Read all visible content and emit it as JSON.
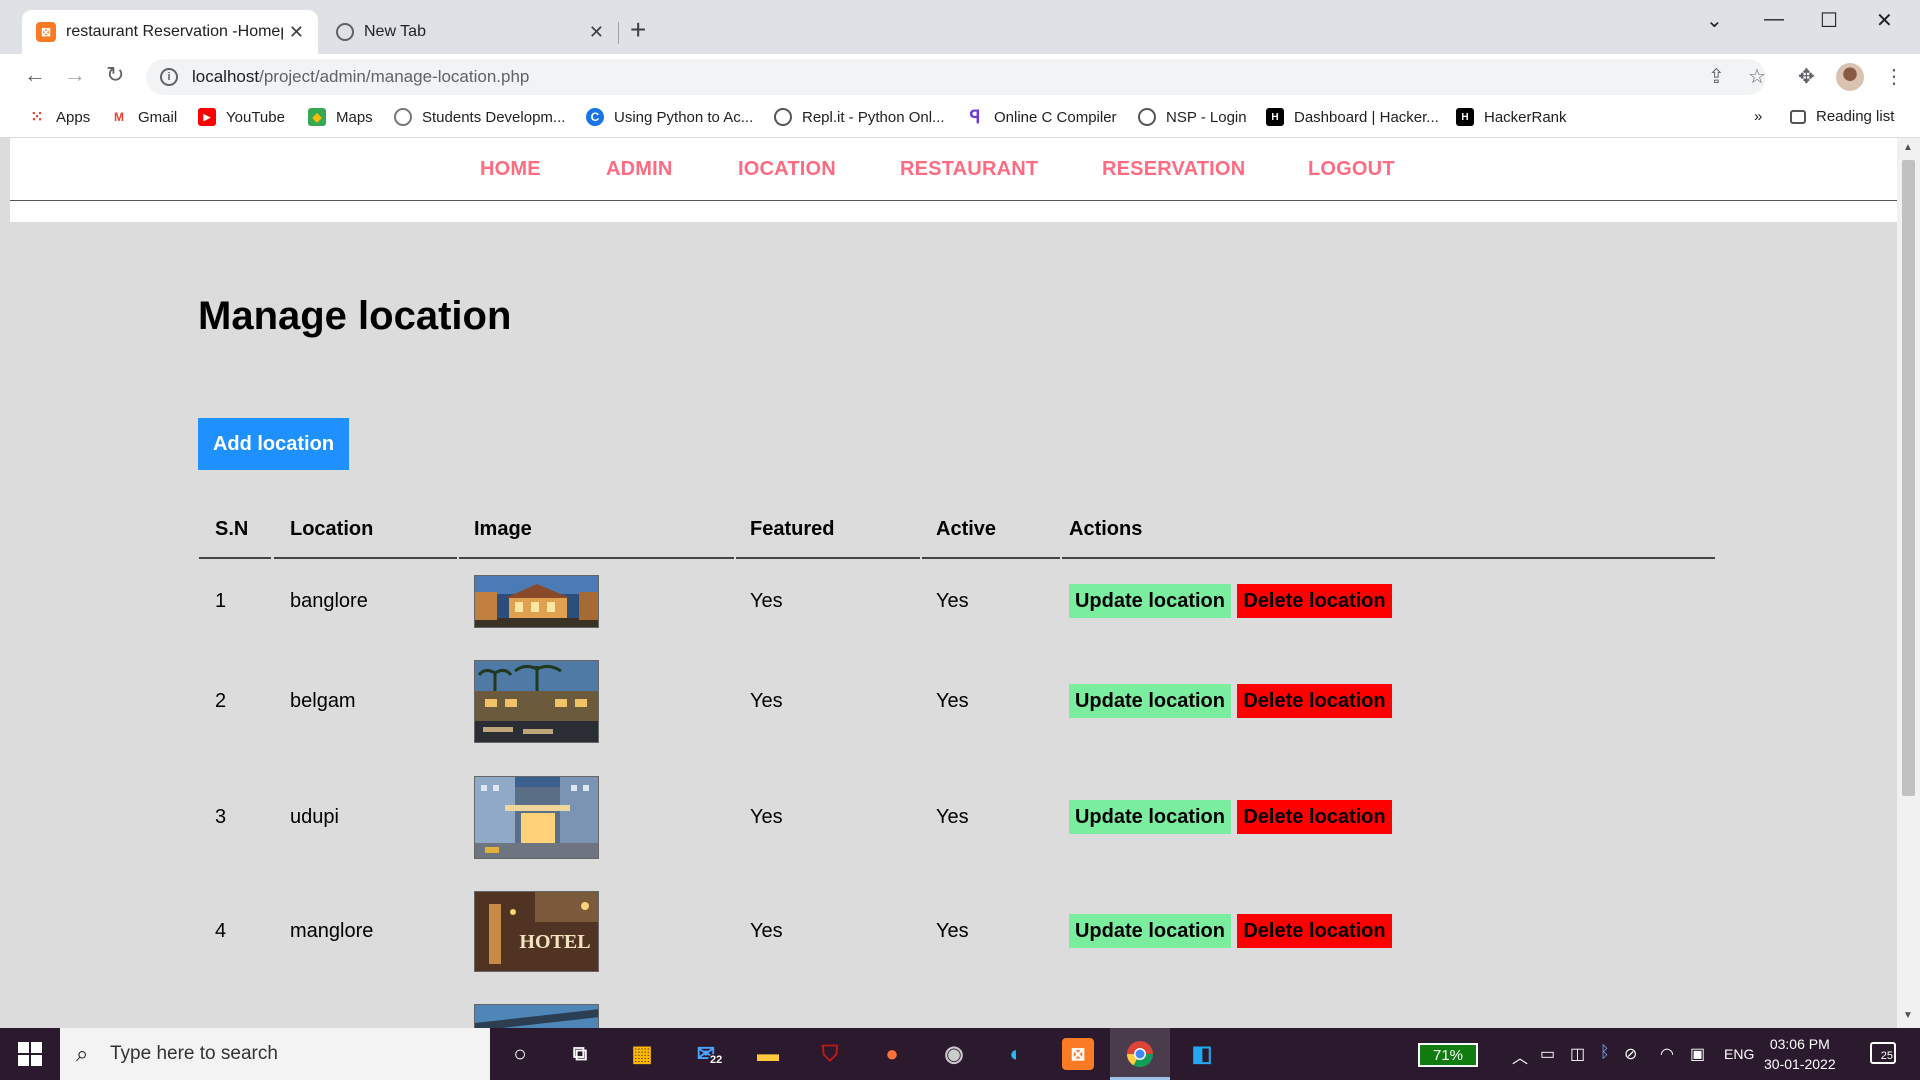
{
  "browser": {
    "tabs": [
      {
        "title": "restaurant Reservation -Homepa",
        "active": true
      },
      {
        "title": "New Tab",
        "active": false
      }
    ],
    "url_host": "localhost",
    "url_path": "/project/admin/manage-location.php",
    "bookmarks": [
      {
        "label": "Apps",
        "icon": "apps-grid-icon"
      },
      {
        "label": "Gmail",
        "icon": "gmail-icon"
      },
      {
        "label": "YouTube",
        "icon": "youtube-icon"
      },
      {
        "label": "Maps",
        "icon": "maps-icon"
      },
      {
        "label": "Students Developm...",
        "icon": "globe-icon"
      },
      {
        "label": "Using Python to Ac...",
        "icon": "c-icon"
      },
      {
        "label": "Repl.it - Python Onl...",
        "icon": "replit-icon"
      },
      {
        "label": "Online C Compiler",
        "icon": "compiler-icon"
      },
      {
        "label": "NSP - Login",
        "icon": "globe-icon"
      },
      {
        "label": "Dashboard | Hacker...",
        "icon": "hackerrank-icon"
      },
      {
        "label": "HackerRank",
        "icon": "hackerrank-icon"
      }
    ],
    "more_bookmarks": "»",
    "reading_list": "Reading list"
  },
  "nav": {
    "home": "HOME",
    "admin": "ADMIN",
    "location": "IOCATION",
    "restaurant": "RESTAURANT",
    "reservation": "RESERVATION",
    "logout": "LOGOUT"
  },
  "page": {
    "title": "Manage location",
    "add_button": "Add location"
  },
  "table": {
    "headers": [
      "S.N",
      "Location",
      "Image",
      "Featured",
      "Active",
      "Actions"
    ],
    "rows": [
      {
        "sn": "1",
        "location": "banglore",
        "featured": "Yes",
        "active": "Yes",
        "update": "Update location",
        "delete": "Delete location"
      },
      {
        "sn": "2",
        "location": "belgam",
        "featured": "Yes",
        "active": "Yes",
        "update": "Update location",
        "delete": "Delete location"
      },
      {
        "sn": "3",
        "location": "udupi",
        "featured": "Yes",
        "active": "Yes",
        "update": "Update location",
        "delete": "Delete location"
      },
      {
        "sn": "4",
        "location": "manglore",
        "featured": "Yes",
        "active": "Yes",
        "update": "Update location",
        "delete": "Delete location"
      }
    ],
    "hotel_sign_text": "HOTEL"
  },
  "taskbar": {
    "search_placeholder": "Type here to search",
    "mail_badge": "22",
    "battery": "71%",
    "language": "ENG",
    "time": "03:06 PM",
    "date": "30-01-2022",
    "notifications": "25"
  },
  "colors": {
    "nav_link": "#ff6b81",
    "add_button": "#1e90ff",
    "update_button": "#7bed9f",
    "delete_button": "#ff0000"
  }
}
